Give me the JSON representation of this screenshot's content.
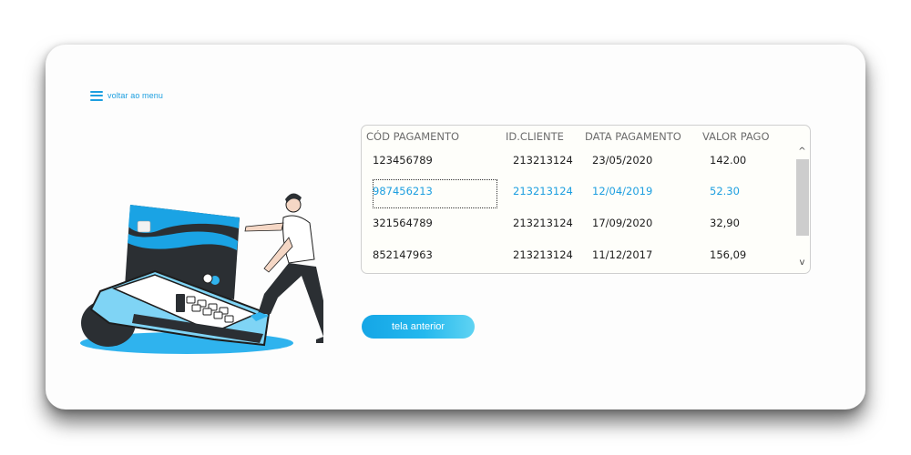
{
  "nav": {
    "back_label": "voltar ao menu"
  },
  "table": {
    "headers": [
      "CÓD PAGAMENTO",
      "ID.CLIENTE",
      "DATA PAGAMENTO",
      "VALOR PAGO"
    ],
    "rows": [
      [
        "123456789",
        "213213124",
        "23/05/2020",
        "142.00"
      ],
      [
        "987456213",
        "213213124",
        "12/04/2019",
        "52.30"
      ],
      [
        "321564789",
        "213213124",
        "17/09/2020",
        "32,90"
      ],
      [
        "852147963",
        "213213124",
        "11/12/2017",
        "156,09"
      ]
    ],
    "selected_row": 1,
    "scroll_up": "^",
    "scroll_down": "v"
  },
  "buttons": {
    "previous_screen": "tela anterior"
  },
  "colors": {
    "accent": "#1d9fe0",
    "card_dark": "#2b2f33",
    "terminal_light": "#7fd4f5"
  },
  "illustration": {
    "icon": "payment-terminal-illustration"
  }
}
